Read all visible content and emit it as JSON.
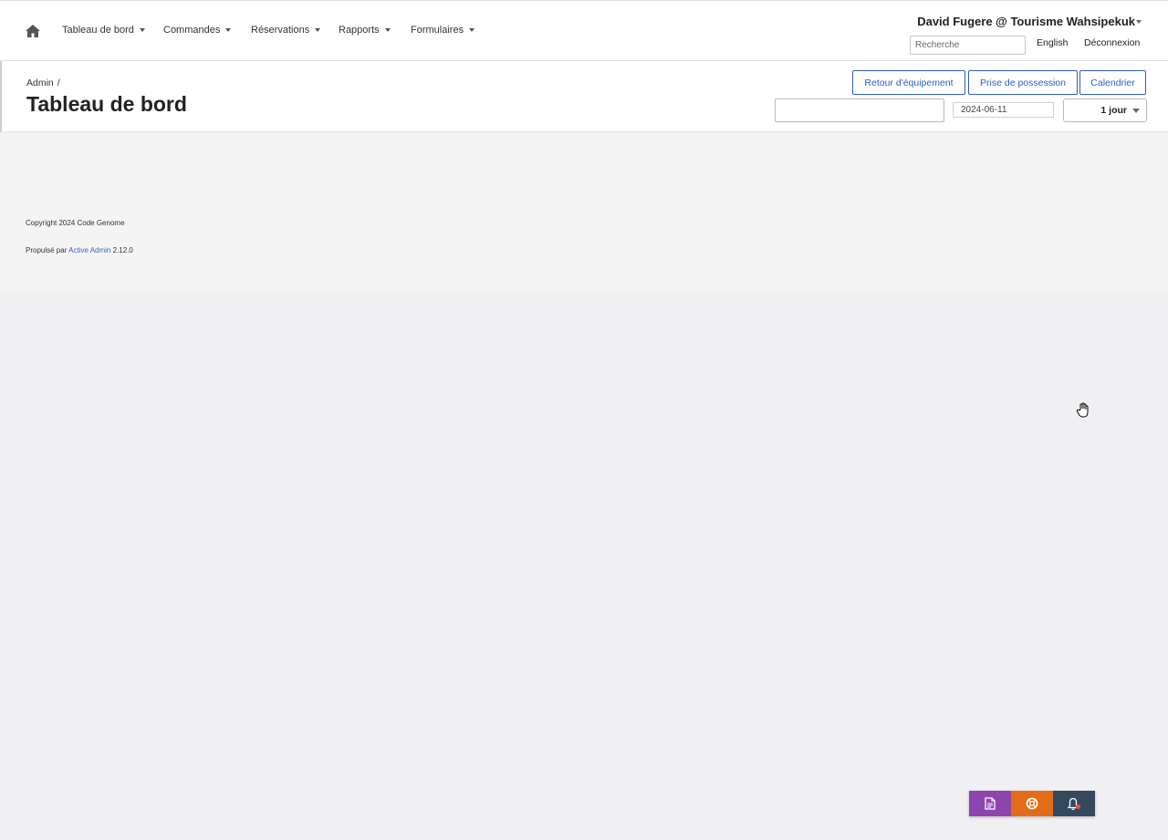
{
  "nav": {
    "items": [
      {
        "label": "Tableau de bord"
      },
      {
        "label": "Commandes"
      },
      {
        "label": "Réservations"
      },
      {
        "label": "Rapports"
      },
      {
        "label": "Formulaires"
      }
    ]
  },
  "user": {
    "name": "David Fugere @ Tourisme Wahsipekuk"
  },
  "search": {
    "placeholder": "Recherche",
    "value": ""
  },
  "header_links": {
    "language": "English",
    "logout": "Déconnexion"
  },
  "breadcrumb": {
    "root": "Admin",
    "separator": "/"
  },
  "page": {
    "title": "Tableau de bord"
  },
  "actions": {
    "return_label": "Retour d'équipement",
    "pickup_label": "Prise de possession",
    "calendar_label": "Calendrier"
  },
  "filters": {
    "date_value": "2024-06-11",
    "period_value": "1 jour"
  },
  "footer": {
    "copyright": "Copyright 2024 Code Genome",
    "powered_prefix": "Propulsé par",
    "powered_link": "Active Admin",
    "version": "2.12.0"
  },
  "colors": {
    "accent": "#2f5fbf",
    "fab_purple": "#8e44ad",
    "fab_orange": "#e36c1a",
    "fab_dark": "#34495e",
    "notification_dot": "#e74c3c"
  },
  "icons": {
    "home": "home-icon",
    "document": "document-icon",
    "help": "lifebuoy-icon",
    "notifications": "bell-icon"
  }
}
